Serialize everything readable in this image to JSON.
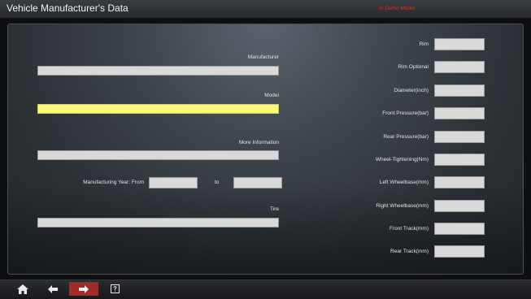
{
  "window": {
    "title": "Vehicle Manufacturer's Data",
    "mode": "In Demo Model"
  },
  "left": {
    "manufacturer_label": "Manufacturer",
    "manufacturer_value": "",
    "model_label": "Model",
    "model_value": "",
    "more_info_label": "More Information",
    "more_info_value": "",
    "year_from_label": "Manufacturing Year: From",
    "year_from_value": "",
    "year_to_label": "to",
    "year_to_value": "",
    "tire_label": "Tire",
    "tire_value": ""
  },
  "right": {
    "fields": [
      {
        "label": "Rim",
        "value": ""
      },
      {
        "label": "Rim Optional",
        "value": ""
      },
      {
        "label": "Diameter(inch)",
        "value": ""
      },
      {
        "label": "Front Pressure(bar)",
        "value": ""
      },
      {
        "label": "Rear Pressure(bar)",
        "value": ""
      },
      {
        "label": "Wheel-Tightening(Nm)",
        "value": ""
      },
      {
        "label": "Left Wheelbase(mm)",
        "value": ""
      },
      {
        "label": "Right Wheelbase(mm)",
        "value": ""
      },
      {
        "label": "Front Track(mm)",
        "value": ""
      },
      {
        "label": "Rear Track(mm)",
        "value": ""
      }
    ]
  },
  "toolbar": {
    "home_icon": "home-icon",
    "back_icon": "arrow-left-icon",
    "next_icon": "arrow-right-icon",
    "help_icon": "help-icon",
    "active_color": "#a12b2b"
  },
  "colors": {
    "demo_text": "#e52828",
    "active_field": "#fbfb7a"
  }
}
